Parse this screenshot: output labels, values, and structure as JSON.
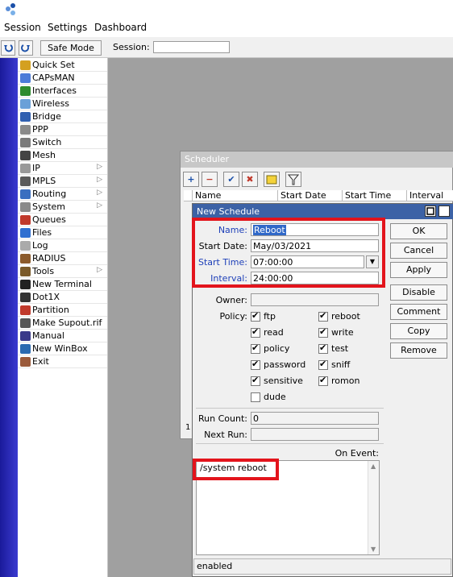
{
  "menu": [
    "Session",
    "Settings",
    "Dashboard"
  ],
  "toolbar": {
    "safe_mode": "Safe Mode",
    "session_label": "Session:",
    "session_value": ""
  },
  "sidebar": [
    {
      "label": "Quick Set",
      "icon": "quick-set-icon",
      "color": "#d4a020",
      "arrow": false
    },
    {
      "label": "CAPsMAN",
      "icon": "capsman-icon",
      "color": "#4b7bd8",
      "arrow": false
    },
    {
      "label": "Interfaces",
      "icon": "interfaces-icon",
      "color": "#2e8b2e",
      "arrow": false
    },
    {
      "label": "Wireless",
      "icon": "wireless-icon",
      "color": "#6aa0d8",
      "arrow": false
    },
    {
      "label": "Bridge",
      "icon": "bridge-icon",
      "color": "#2f5fb0",
      "arrow": false
    },
    {
      "label": "PPP",
      "icon": "ppp-icon",
      "color": "#8a8a8a",
      "arrow": false
    },
    {
      "label": "Switch",
      "icon": "switch-icon",
      "color": "#7a7a7a",
      "arrow": false
    },
    {
      "label": "Mesh",
      "icon": "mesh-icon",
      "color": "#444444",
      "arrow": false
    },
    {
      "label": "IP",
      "icon": "ip-icon",
      "color": "#999999",
      "arrow": true
    },
    {
      "label": "MPLS",
      "icon": "mpls-icon",
      "color": "#5a5a5a",
      "arrow": true
    },
    {
      "label": "Routing",
      "icon": "routing-icon",
      "color": "#3a6fc0",
      "arrow": true
    },
    {
      "label": "System",
      "icon": "system-icon",
      "color": "#8a8a8a",
      "arrow": true
    },
    {
      "label": "Queues",
      "icon": "queues-icon",
      "color": "#c0392b",
      "arrow": false
    },
    {
      "label": "Files",
      "icon": "files-icon",
      "color": "#2f6fd0",
      "arrow": false
    },
    {
      "label": "Log",
      "icon": "log-icon",
      "color": "#aaaaaa",
      "arrow": false
    },
    {
      "label": "RADIUS",
      "icon": "radius-icon",
      "color": "#8b5a2b",
      "arrow": false
    },
    {
      "label": "Tools",
      "icon": "tools-icon",
      "color": "#7a5a2a",
      "arrow": true
    },
    {
      "label": "New Terminal",
      "icon": "terminal-icon",
      "color": "#222222",
      "arrow": false
    },
    {
      "label": "Dot1X",
      "icon": "dot1x-icon",
      "color": "#333333",
      "arrow": false
    },
    {
      "label": "Partition",
      "icon": "partition-icon",
      "color": "#c0392b",
      "arrow": false
    },
    {
      "label": "Make Supout.rif",
      "icon": "supout-icon",
      "color": "#555555",
      "arrow": false
    },
    {
      "label": "Manual",
      "icon": "manual-icon",
      "color": "#3a3a8a",
      "arrow": false
    },
    {
      "label": "New WinBox",
      "icon": "winbox-icon",
      "color": "#2a6ab0",
      "arrow": false
    },
    {
      "label": "Exit",
      "icon": "exit-icon",
      "color": "#9a5a3a",
      "arrow": false
    }
  ],
  "scheduler": {
    "title": "Scheduler",
    "columns": [
      "Name",
      "Start Date",
      "Start Time",
      "Interval"
    ],
    "row_hint": "1"
  },
  "dialog": {
    "title": "New Schedule",
    "name_label": "Name:",
    "name_value": "Reboot",
    "start_date_label": "Start Date:",
    "start_date_value": "May/03/2021",
    "start_time_label": "Start Time:",
    "start_time_value": "07:00:00",
    "interval_label": "Interval:",
    "interval_value": "24:00:00",
    "owner_label": "Owner:",
    "owner_value": "",
    "policy_label": "Policy:",
    "policies": [
      {
        "label": "ftp",
        "checked": true
      },
      {
        "label": "reboot",
        "checked": true
      },
      {
        "label": "read",
        "checked": true
      },
      {
        "label": "write",
        "checked": true
      },
      {
        "label": "policy",
        "checked": true
      },
      {
        "label": "test",
        "checked": true
      },
      {
        "label": "password",
        "checked": true
      },
      {
        "label": "sniff",
        "checked": true
      },
      {
        "label": "sensitive",
        "checked": true
      },
      {
        "label": "romon",
        "checked": true
      },
      {
        "label": "dude",
        "checked": false
      }
    ],
    "run_count_label": "Run Count:",
    "run_count_value": "0",
    "next_run_label": "Next Run:",
    "next_run_value": "",
    "on_event_label": "On Event:",
    "on_event_value": "/system reboot",
    "status": "enabled",
    "buttons": [
      "OK",
      "Cancel",
      "Apply",
      "Disable",
      "Comment",
      "Copy",
      "Remove"
    ]
  },
  "colors": {
    "highlight": "#e3141c",
    "title_bar": "#3c62a6"
  }
}
